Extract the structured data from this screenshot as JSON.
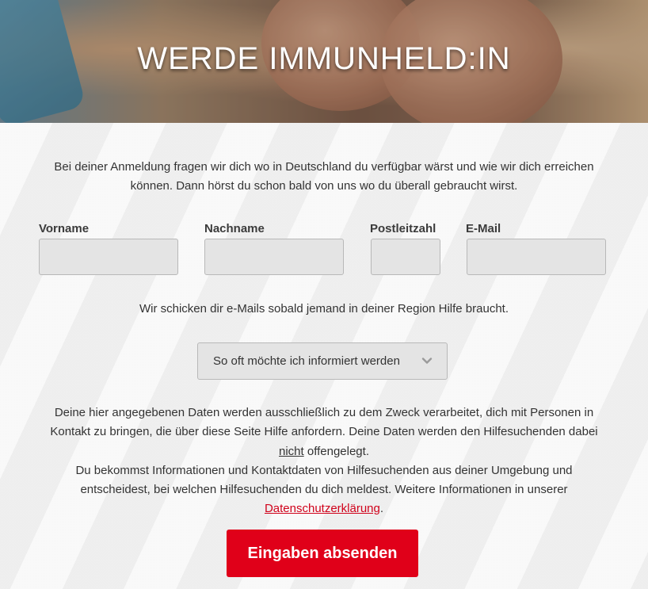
{
  "hero": {
    "title": "WERDE IMMUNHELD:IN"
  },
  "intro": {
    "text": "Bei deiner Anmeldung fragen wir dich wo in Deutschland du verfügbar wärst und wie wir dich erreichen können. Dann hörst du schon bald von uns wo du überall gebraucht wirst."
  },
  "form": {
    "fields": [
      {
        "label": "Vorname",
        "value": ""
      },
      {
        "label": "Nachname",
        "value": ""
      },
      {
        "label": "Postleitzahl",
        "value": ""
      },
      {
        "label": "E-Mail",
        "value": ""
      }
    ],
    "notice": "Wir schicken dir e-Mails sobald jemand in deiner Region Hilfe braucht.",
    "frequency_select": {
      "selected": "So oft möchte ich informiert werden",
      "icon": "chevron-down-icon"
    }
  },
  "privacy": {
    "line1": "Deine hier angegebenen Daten werden ausschließlich zu dem Zweck verarbeitet, dich mit Personen in Kontakt zu bringen, die über diese Seite Hilfe anfordern. Deine Daten werden den Hilfesuchenden dabei ",
    "emphasis": "nicht",
    "line1_end": " offengelegt.",
    "line2": "Du bekommst Informationen und Kontaktdaten von Hilfesuchenden aus deiner Umgebung und entscheidest, bei welchen Hilfesuchenden du dich meldest. Weitere Informationen in unserer ",
    "link_text": "Datenschutzerklärung",
    "line2_end": "."
  },
  "submit": {
    "label": "Eingaben absenden"
  },
  "colors": {
    "accent": "#e00019",
    "link": "#d0021b",
    "input_bg": "#e4e4e4"
  }
}
